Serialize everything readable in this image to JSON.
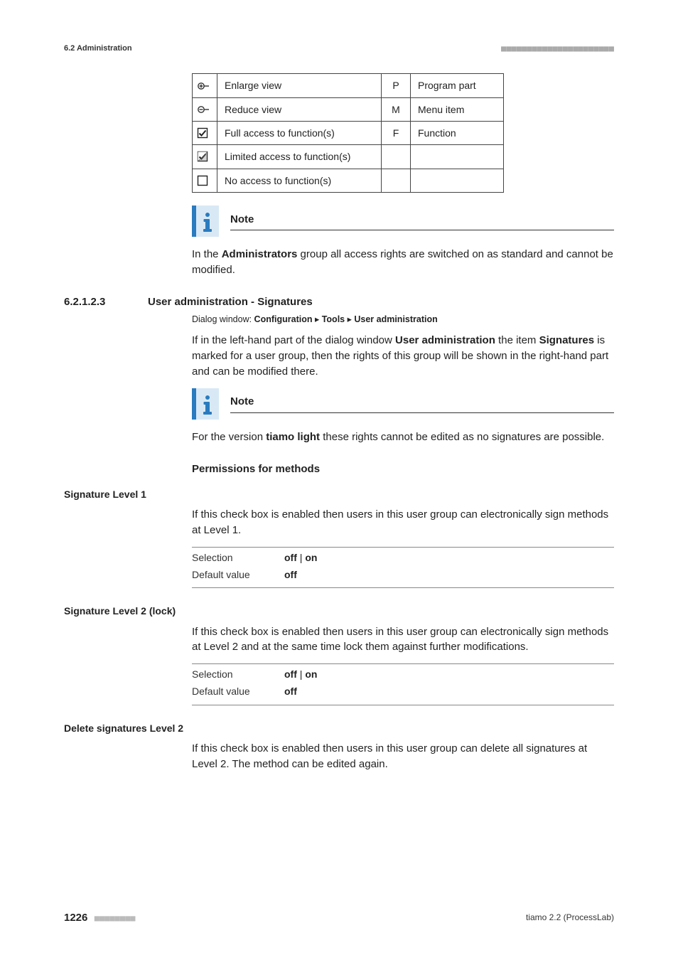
{
  "header": {
    "left": "6.2 Administration",
    "dots": "■■■■■■■■■■■■■■■■■■■■■■"
  },
  "legend": {
    "rows": [
      {
        "icon": "enlarge-icon",
        "label": "Enlarge view",
        "code": "P",
        "desc": "Program part"
      },
      {
        "icon": "reduce-icon",
        "label": "Reduce view",
        "code": "M",
        "desc": "Menu item"
      },
      {
        "icon": "check-full-icon",
        "label": "Full access to function(s)",
        "code": "F",
        "desc": "Function"
      },
      {
        "icon": "check-partial-icon",
        "label": "Limited access to function(s)",
        "code": "",
        "desc": ""
      },
      {
        "icon": "check-none-icon",
        "label": "No access to function(s)",
        "code": "",
        "desc": ""
      }
    ]
  },
  "note1": {
    "title": "Note",
    "body_pre": "In the ",
    "body_bold": "Administrators",
    "body_post": " group all access rights are switched on as standard and cannot be modified."
  },
  "section": {
    "number": "6.2.1.2.3",
    "title": "User administration - Signatures"
  },
  "dialog_path": {
    "prefix": "Dialog window: ",
    "p1": "Configuration",
    "p2": "Tools",
    "p3": "User administration"
  },
  "intro": {
    "t1": "If in the left-hand part of the dialog window ",
    "b1": "User administration",
    "t2": " the item ",
    "b2": "Signatures",
    "t3": " is marked for a user group, then the rights of this group will be shown in the right-hand part and can be modified there."
  },
  "note2": {
    "title": "Note",
    "body_pre": "For the version ",
    "body_bold": "tiamo light",
    "body_post": " these rights cannot be edited as no signatures are possible."
  },
  "perm_heading": "Permissions for methods",
  "sig1": {
    "title": "Signature Level 1",
    "desc": "If this check box is enabled then users in this user group can electronically sign methods at Level 1.",
    "sel_label": "Selection",
    "sel_value": "off | on",
    "def_label": "Default value",
    "def_value": "off"
  },
  "sig2": {
    "title": "Signature Level 2 (lock)",
    "desc": "If this check box is enabled then users in this user group can electronically sign methods at Level 2 and at the same time lock them against further modifications.",
    "sel_label": "Selection",
    "sel_value": "off | on",
    "def_label": "Default value",
    "def_value": "off"
  },
  "del2": {
    "title": "Delete signatures Level 2",
    "desc": "If this check box is enabled then users in this user group can delete all signatures at Level 2. The method can be edited again."
  },
  "footer": {
    "page": "1226",
    "dots": "■■■■■■■■",
    "product": "tiamo 2.2 (ProcessLab)"
  }
}
